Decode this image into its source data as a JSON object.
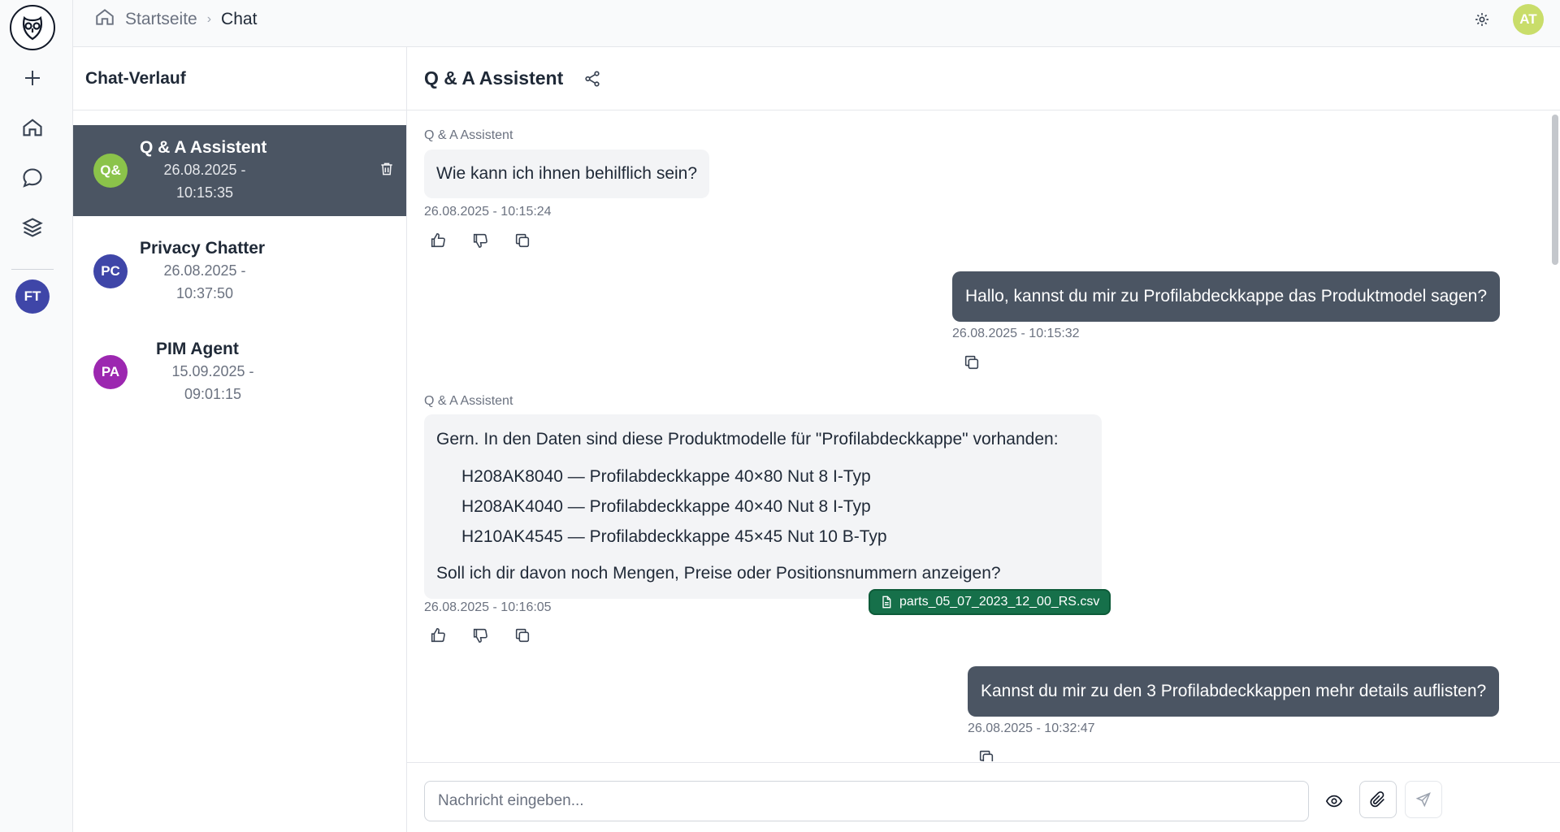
{
  "breadcrumb": {
    "home": "Startseite",
    "separator": "›",
    "current": "Chat"
  },
  "top": {
    "avatar": "AT",
    "avatar_color": "#c9dd6a"
  },
  "rail": {
    "user_avatar": "FT",
    "user_avatar_color": "#3f46a8"
  },
  "history": {
    "title": "Chat-Verlauf",
    "items": [
      {
        "initials": "Q&",
        "name": "Q & A Assistent",
        "date": "26.08.2025 -",
        "time": "10:15:35",
        "color": "#8bc34a",
        "active": true
      },
      {
        "initials": "PC",
        "name": "Privacy Chatter",
        "date": "26.08.2025 -",
        "time": "10:37:50",
        "color": "#3f46a8",
        "active": false
      },
      {
        "initials": "PA",
        "name": "PIM Agent",
        "date": "15.09.2025 -",
        "time": "09:01:15",
        "color": "#9c27b0",
        "active": false
      }
    ]
  },
  "chat": {
    "title": "Q & A Assistent",
    "messages": {
      "m1": {
        "sender": "Q & A Assistent",
        "text": "Wie kann ich ihnen behilflich sein?",
        "timestamp": "26.08.2025 - 10:15:24"
      },
      "m2": {
        "text": "Hallo, kannst du mir zu Profilabdeckkappe das Produktmodel sagen?",
        "timestamp": "26.08.2025 - 10:15:32"
      },
      "m3": {
        "sender": "Q & A Assistent",
        "intro": "Gern. In den Daten sind diese Produktmodelle für \"Profilabdeckkappe\" vorhanden:",
        "items": [
          "H208AK8040 — Profilabdeckkappe 40×80 Nut 8 I-Typ",
          "H208AK4040 — Profilabdeckkappe 40×40 Nut 8 I-Typ",
          "H210AK4545 — Profilabdeckkappe 45×45 Nut 10 B-Typ"
        ],
        "outro": "Soll ich dir davon noch Mengen, Preise oder Positionsnummern anzeigen?",
        "attachment": "parts_05_07_2023_12_00_RS.csv",
        "timestamp": "26.08.2025 - 10:16:05"
      },
      "m4": {
        "text": "Kannst du mir zu den 3 Profilabdeckkappen mehr details auflisten?",
        "timestamp": "26.08.2025 - 10:32:47"
      }
    }
  },
  "composer": {
    "placeholder": "Nachricht eingeben..."
  },
  "colors": {
    "accent_dark": "#4b5563",
    "attachment_green": "#16704a"
  }
}
